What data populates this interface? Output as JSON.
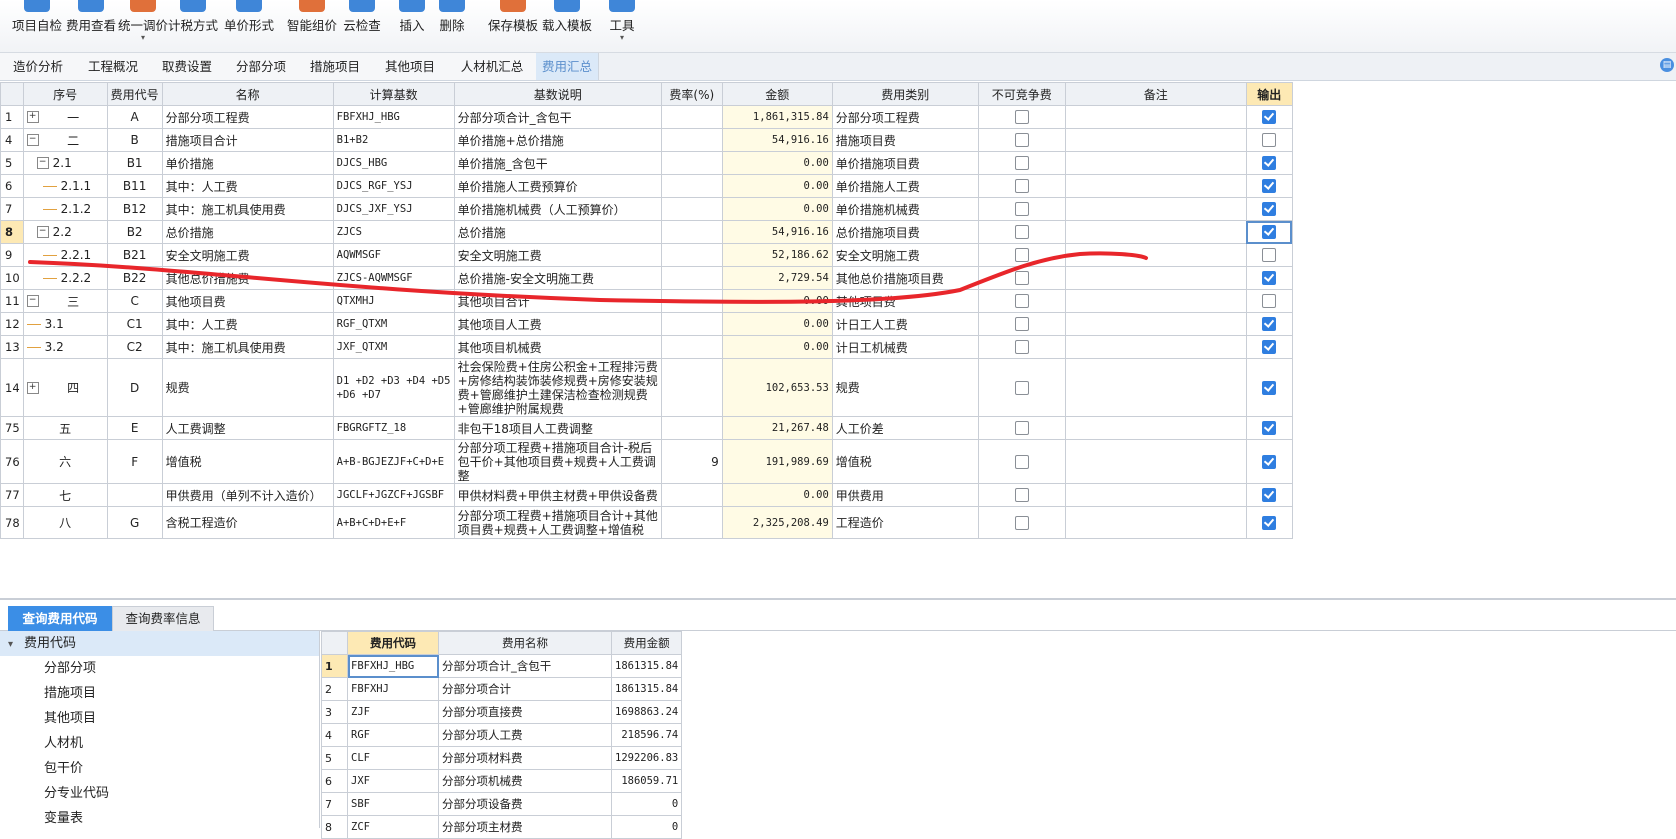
{
  "toolbar": {
    "buttons": [
      {
        "label": "项目自检",
        "color": "#3f86d8"
      },
      {
        "label": "费用查看",
        "color": "#3f86d8"
      },
      {
        "label": "统一调价",
        "color": "#e0703a",
        "caret": "▾"
      },
      {
        "label": "计税方式",
        "color": "#3f86d8"
      },
      {
        "label": "单价形式",
        "color": "#3f86d8"
      },
      {
        "label": "智能组价",
        "color": "#e0703a"
      },
      {
        "label": "云检查",
        "color": "#3f86d8"
      },
      {
        "label": "插入",
        "color": "#3f86d8"
      },
      {
        "label": "删除",
        "color": "#3f86d8"
      },
      {
        "label": "保存模板",
        "color": "#e0703a"
      },
      {
        "label": "载入模板",
        "color": "#3f86d8"
      },
      {
        "label": "工具",
        "color": "#3f86d8",
        "caret": "▾"
      }
    ]
  },
  "tabs": [
    "造价分析",
    "工程概况",
    "取费设置",
    "分部分项",
    "措施项目",
    "其他项目",
    "人材机汇总",
    "费用汇总"
  ],
  "active_tab": "费用汇总",
  "grid": {
    "headers": [
      "序号",
      "费用代号",
      "名称",
      "计算基数",
      "基数说明",
      "费率(%)",
      "金额",
      "费用类别",
      "不可竞争费",
      "备注",
      "输出"
    ],
    "rows": [
      {
        "n": "1",
        "pm": "+",
        "seq": "一",
        "code": "A",
        "name": "分部分项工程费",
        "base": "FBFXHJ_HBG",
        "desc": "分部分项合计_含包干",
        "rate": "",
        "amount": "1,861,315.84",
        "cat": "分部分项工程费",
        "nc": false,
        "note": "",
        "out": true
      },
      {
        "n": "4",
        "pm": "−",
        "seq": "二",
        "code": "B",
        "name": "措施项目合计",
        "base": "B1+B2",
        "desc": "单价措施+总价措施",
        "rate": "",
        "amount": "54,916.16",
        "cat": "措施项目费",
        "nc": false,
        "note": "",
        "out": false
      },
      {
        "n": "5",
        "pm": "−",
        "seq": "2.1",
        "code": "B1",
        "name": "单价措施",
        "base": "DJCS_HBG",
        "desc": "单价措施_含包干",
        "rate": "",
        "amount": "0.00",
        "cat": "单价措施项目费",
        "nc": false,
        "note": "",
        "out": true
      },
      {
        "n": "6",
        "pm": "",
        "seq": "2.1.1",
        "code": "B11",
        "name": "其中：人工费",
        "base": "DJCS_RGF_YSJ",
        "desc": "单价措施人工费预算价",
        "rate": "",
        "amount": "0.00",
        "cat": "单价措施人工费",
        "nc": false,
        "note": "",
        "out": true
      },
      {
        "n": "7",
        "pm": "",
        "seq": "2.1.2",
        "code": "B12",
        "name": "其中：施工机具使用费",
        "base": "DJCS_JXF_YSJ",
        "desc": "单价措施机械费（人工预算价）",
        "rate": "",
        "amount": "0.00",
        "cat": "单价措施机械费",
        "nc": false,
        "note": "",
        "out": true
      },
      {
        "n": "8",
        "pm": "−",
        "seq": "2.2",
        "code": "B2",
        "name": "总价措施",
        "base": "ZJCS",
        "desc": "总价措施",
        "rate": "",
        "amount": "54,916.16",
        "cat": "总价措施项目费",
        "nc": false,
        "note": "",
        "out": true,
        "sel": true
      },
      {
        "n": "9",
        "pm": "",
        "seq": "2.2.1",
        "code": "B21",
        "name": "安全文明施工费",
        "base": "AQWMSGF",
        "desc": "安全文明施工费",
        "rate": "",
        "amount": "52,186.62",
        "cat": "安全文明施工费",
        "nc": false,
        "note": "",
        "out": false
      },
      {
        "n": "10",
        "pm": "",
        "seq": "2.2.2",
        "code": "B22",
        "name": "其他总价措施费",
        "base": "ZJCS-AQWMSGF",
        "desc": "总价措施-安全文明施工费",
        "rate": "",
        "amount": "2,729.54",
        "cat": "其他总价措施项目费",
        "nc": false,
        "note": "",
        "out": true
      },
      {
        "n": "11",
        "pm": "−",
        "seq": "三",
        "code": "C",
        "name": "其他项目费",
        "base": "QTXMHJ",
        "desc": "其他项目合计",
        "rate": "",
        "amount": "0.00",
        "cat": "其他项目费",
        "nc": false,
        "note": "",
        "out": false
      },
      {
        "n": "12",
        "pm": "",
        "seq": "3.1",
        "code": "C1",
        "name": "其中：人工费",
        "base": "RGF_QTXM",
        "desc": "其他项目人工费",
        "rate": "",
        "amount": "0.00",
        "cat": "计日工人工费",
        "nc": false,
        "note": "",
        "out": true
      },
      {
        "n": "13",
        "pm": "",
        "seq": "3.2",
        "code": "C2",
        "name": "其中：施工机具使用费",
        "base": "JXF_QTXM",
        "desc": "其他项目机械费",
        "rate": "",
        "amount": "0.00",
        "cat": "计日工机械费",
        "nc": false,
        "note": "",
        "out": true
      },
      {
        "n": "14",
        "pm": "+",
        "seq": "四",
        "code": "D",
        "name": "规费",
        "base": "D1 +D2 +D3 +D4 +D5 +D6 +D7",
        "desc": "社会保险费+住房公积金+工程排污费+房修结构装饰装修规费+房修安装规费+管廊维护土建保洁检查检测规费+管廊维护附属规费",
        "rate": "",
        "amount": "102,653.53",
        "cat": "规费",
        "nc": false,
        "note": "",
        "out": true,
        "tall": 58
      },
      {
        "n": "75",
        "pm": "",
        "seq": "五",
        "code": "E",
        "name": "人工费调整",
        "base": "FBGRGFTZ_18",
        "desc": "非包干18项目人工费调整",
        "rate": "",
        "amount": "21,267.48",
        "cat": "人工价差",
        "nc": false,
        "note": "",
        "out": true
      },
      {
        "n": "76",
        "pm": "",
        "seq": "六",
        "code": "F",
        "name": "增值税",
        "base": "A+B-BGJEZJF+C+D+E",
        "desc": "分部分项工程费+措施项目合计-税后包干价+其他项目费+规费+人工费调整",
        "rate": "9",
        "amount": "191,989.69",
        "cat": "增值税",
        "nc": false,
        "note": "",
        "out": true,
        "tall": 44
      },
      {
        "n": "77",
        "pm": "",
        "seq": "七",
        "code": "",
        "name": "甲供费用（单列不计入造价）",
        "base": "JGCLF+JGZCF+JGSBF",
        "desc": "甲供材料费+甲供主材费+甲供设备费",
        "rate": "",
        "amount": "0.00",
        "cat": "甲供费用",
        "nc": false,
        "note": "",
        "out": true
      },
      {
        "n": "78",
        "pm": "",
        "seq": "八",
        "code": "G",
        "name": "含税工程造价",
        "base": "A+B+C+D+E+F",
        "desc": "分部分项工程费+措施项目合计+其他项目费+规费+人工费调整+增值税",
        "rate": "",
        "amount": "2,325,208.49",
        "cat": "工程造价",
        "nc": false,
        "note": "",
        "out": true,
        "tall": 32
      }
    ]
  },
  "bottom_tabs": [
    "查询费用代码",
    "查询费率信息"
  ],
  "code_tree": {
    "root": "费用代码",
    "items": [
      "分部分项",
      "措施项目",
      "其他项目",
      "人材机",
      "包干价",
      "分专业代码",
      "变量表"
    ]
  },
  "code_grid": {
    "headers": [
      "费用代码",
      "费用名称",
      "费用金额"
    ],
    "rows": [
      {
        "n": "1",
        "code": "FBFXHJ_HBG",
        "name": "分部分项合计_含包干",
        "amt": "1861315.84",
        "sel": true
      },
      {
        "n": "2",
        "code": "FBFXHJ",
        "name": "分部分项合计",
        "amt": "1861315.84"
      },
      {
        "n": "3",
        "code": "ZJF",
        "name": "分部分项直接费",
        "amt": "1698863.24"
      },
      {
        "n": "4",
        "code": "RGF",
        "name": "分部分项人工费",
        "amt": "218596.74"
      },
      {
        "n": "5",
        "code": "CLF",
        "name": "分部分项材料费",
        "amt": "1292206.83"
      },
      {
        "n": "6",
        "code": "JXF",
        "name": "分部分项机械费",
        "amt": "186059.71"
      },
      {
        "n": "7",
        "code": "SBF",
        "name": "分部分项设备费",
        "amt": "0"
      },
      {
        "n": "8",
        "code": "ZCF",
        "name": "分部分项主材费",
        "amt": "0"
      }
    ]
  }
}
